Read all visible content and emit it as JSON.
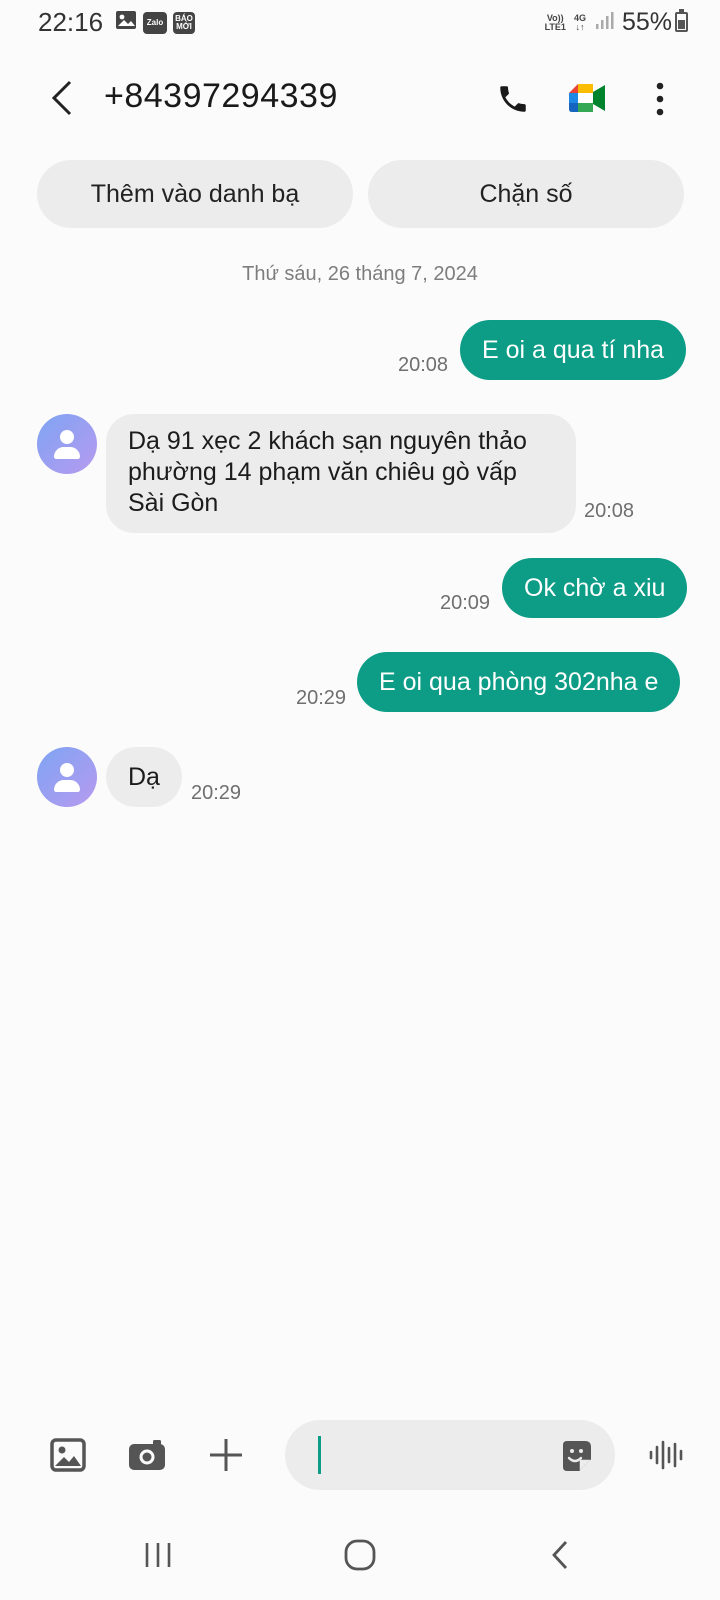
{
  "status_bar": {
    "time": "22:16",
    "notif_zalo": "Zalo",
    "notif_baomoi_1": "BÁO",
    "notif_baomoi_2": "MỚI",
    "volte_1": "Vo))",
    "volte_2": "LTE1",
    "net_1": "4G",
    "net_2": "↓↑",
    "battery_pct": "55%",
    "battery_level": 0.55
  },
  "header": {
    "contact_number": "+84397294339",
    "icons": [
      "back-icon",
      "phone-icon",
      "video-call-icon",
      "more-vert-icon"
    ]
  },
  "actions": {
    "add_contact": "Thêm vào danh bạ",
    "block_number": "Chặn số"
  },
  "date_separator": "Thứ sáu, 26 tháng 7, 2024",
  "messages": [
    {
      "direction": "outgoing",
      "text": "E oi a qua tí nha",
      "time": "20:08"
    },
    {
      "direction": "incoming",
      "line1": "Dạ 91 xẹc 2 khách sạn nguyên thảo",
      "line2": "phường 14 phạm văn chiêu gò vấp",
      "line3": "Sài Gòn",
      "time": "20:08"
    },
    {
      "direction": "outgoing",
      "text": "Ok chờ a xiu",
      "time": "20:09"
    },
    {
      "direction": "outgoing",
      "text": "E oi qua phòng 302nha e",
      "time": "20:29"
    },
    {
      "direction": "incoming",
      "text": "Dạ",
      "time": "20:29"
    }
  ],
  "composer": {
    "value": "",
    "icons": [
      "gallery-icon",
      "camera-icon",
      "plus-icon",
      "sticker-icon",
      "voice-icon"
    ]
  },
  "colors": {
    "outgoing_bubble": "#0d9c86",
    "incoming_bubble": "#ececec",
    "background": "#fbfbfb"
  }
}
